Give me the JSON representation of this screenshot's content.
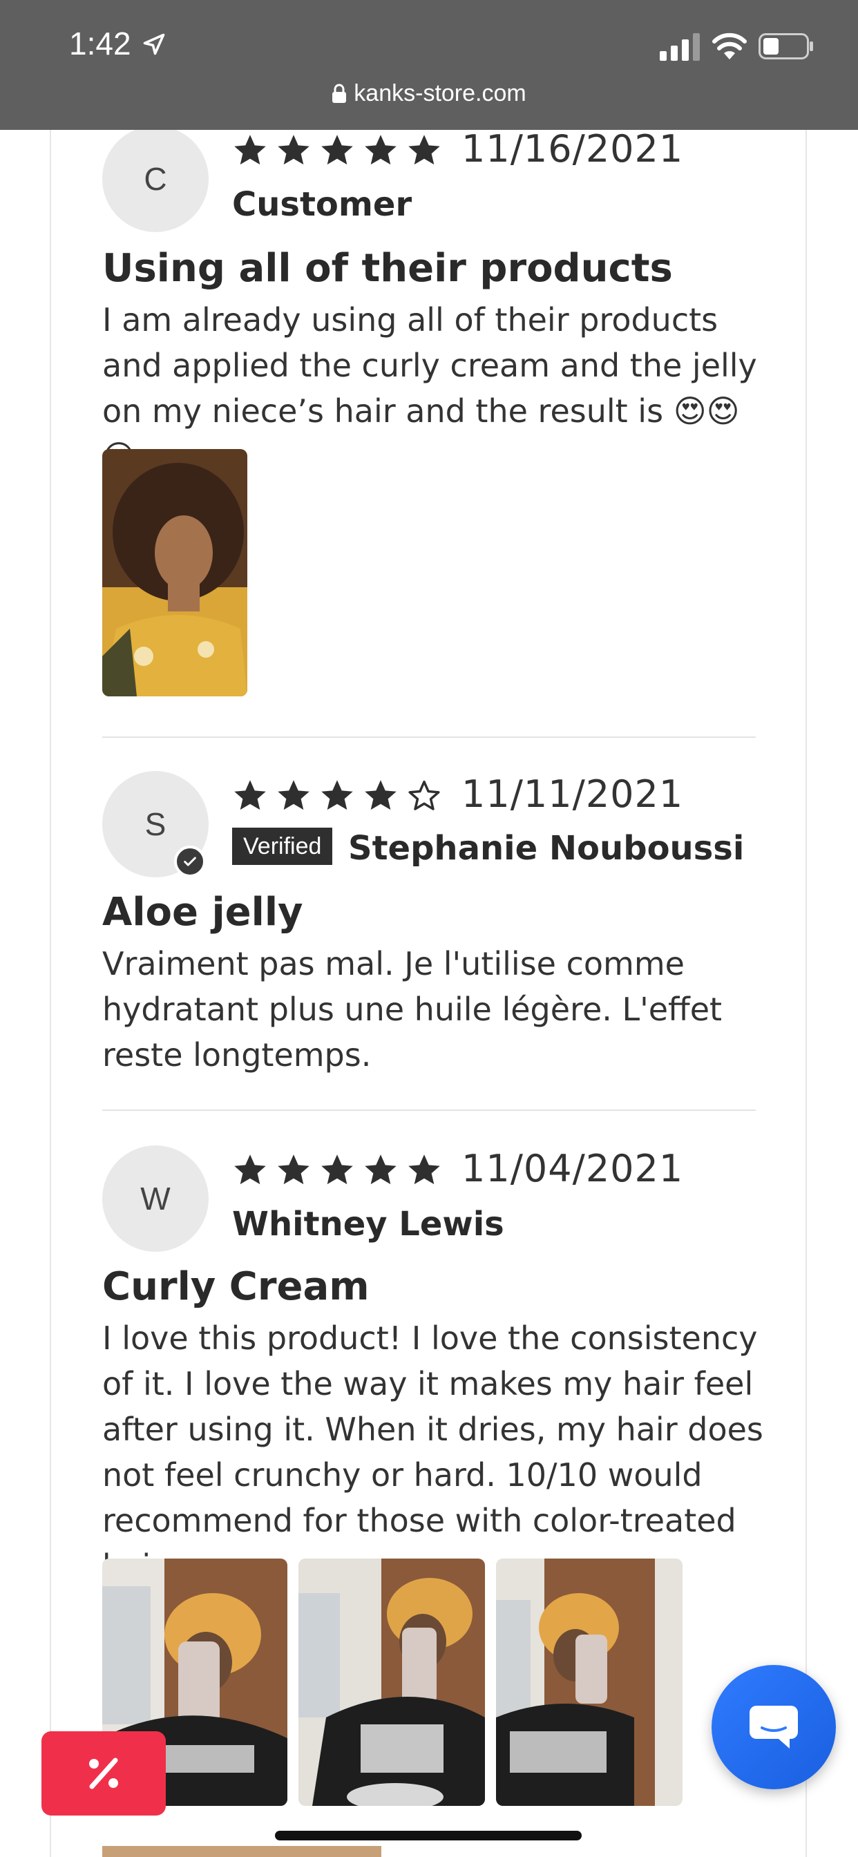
{
  "status_bar": {
    "time": "1:42",
    "url": "kanks-store.com"
  },
  "reviews": [
    {
      "avatar_letter": "C",
      "rating": 5,
      "date": "11/16/2021",
      "author": "Customer",
      "verified": false,
      "title": "Using all of their products",
      "body": "I am already using all of their products and applied the curly cream and the jelly on my niece’s hair and the result is",
      "emoji": "😍😍😍",
      "photo_count": 1
    },
    {
      "avatar_letter": "S",
      "rating": 4,
      "date": "11/11/2021",
      "author": "Stephanie Nouboussi",
      "verified": true,
      "badge_label": "Verified",
      "title": "Aloe jelly",
      "body": "Vraiment pas mal. Je l'utilise comme hydratant plus une huile légère. L'effet reste longtemps."
    },
    {
      "avatar_letter": "W",
      "rating": 5,
      "date": "11/04/2021",
      "author": "Whitney Lewis",
      "verified": false,
      "title": "Curly Cream",
      "body": "I love this product! I love the consistency of it. I love the way it makes my hair feel after using it. When it dries, my hair does not feel crunchy or hard. 10/10 would recommend for those with color-treated hair.",
      "photo_count": 3
    }
  ],
  "icons": {
    "chat": "chat-bubble-icon",
    "discount": "percent-icon"
  },
  "colors": {
    "status_bar_bg": "#5f5f5f",
    "chat_button": "#2f7bff",
    "discount_button": "#f0304a",
    "badge_bg": "#2f2f2f"
  }
}
